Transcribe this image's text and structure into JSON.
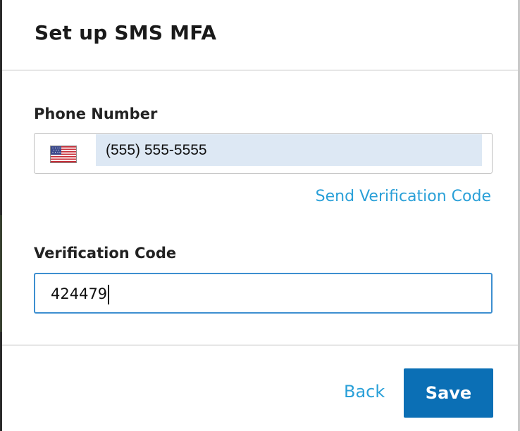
{
  "modal": {
    "title": "Set up SMS MFA"
  },
  "phone": {
    "label": "Phone Number",
    "country_flag": "flag-us-icon",
    "value": "(555) 555-5555",
    "send_code_link": "Send Verification Code"
  },
  "verification": {
    "label": "Verification Code",
    "value": "424479"
  },
  "footer": {
    "back_label": "Back",
    "save_label": "Save"
  },
  "colors": {
    "link": "#2aa0d8",
    "primary_button": "#0b6fb5",
    "focus_border": "#3d8fd0",
    "autofill_bg": "#dde8f4"
  }
}
